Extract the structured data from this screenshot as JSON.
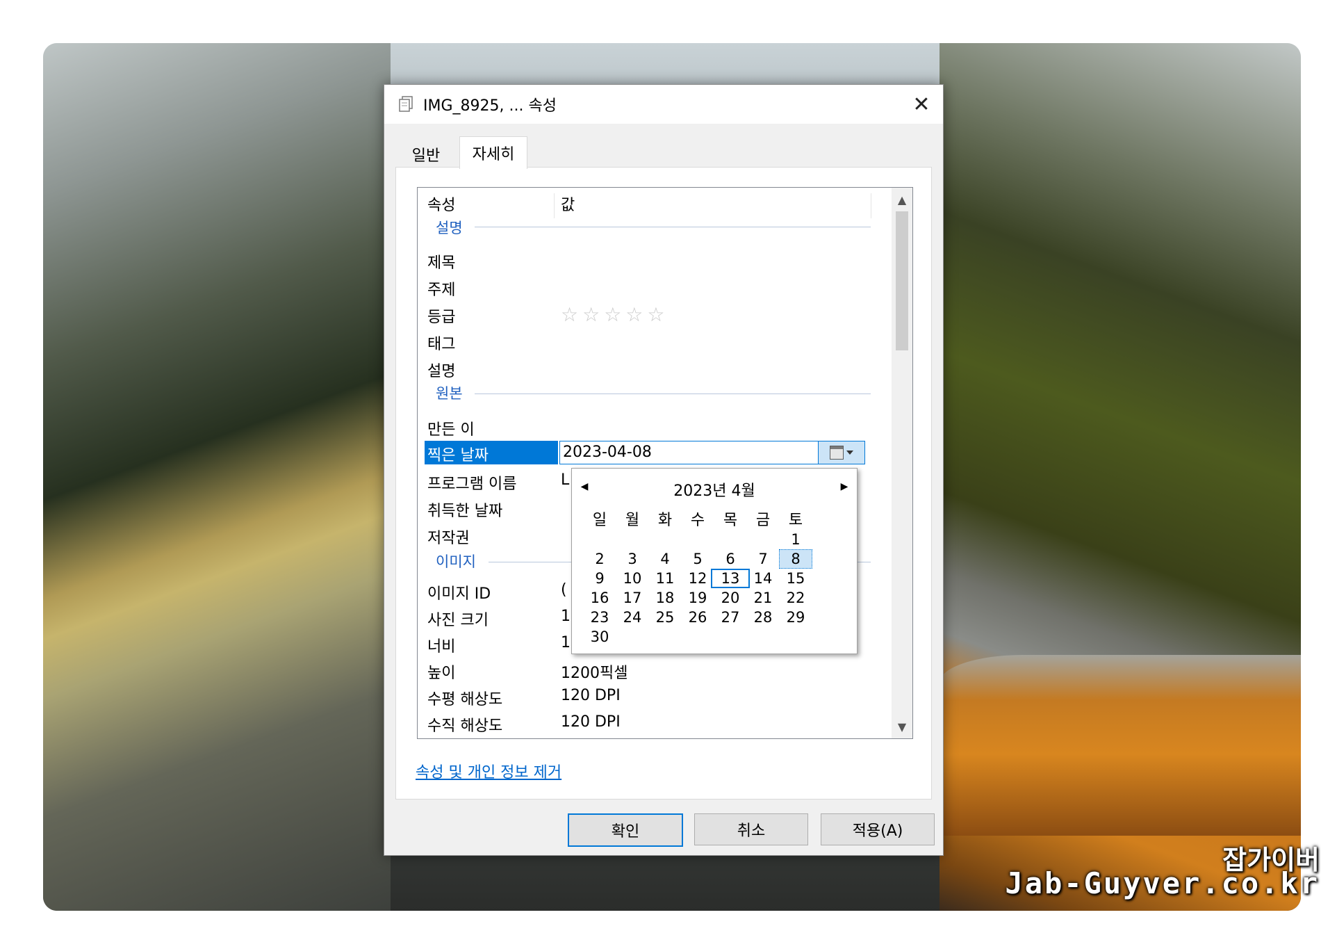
{
  "window": {
    "title": "IMG_8925, ... 속성",
    "close_glyph": "✕",
    "title_icon": "file-properties-icon"
  },
  "tabs": [
    {
      "label": "일반",
      "active": false
    },
    {
      "label": "자세히",
      "active": true
    }
  ],
  "list": {
    "headers": {
      "property": "속성",
      "value": "값"
    },
    "groups": {
      "description": "설명",
      "origin": "원본",
      "image": "이미지"
    },
    "rows": {
      "title": {
        "label": "제목",
        "value": ""
      },
      "subject": {
        "label": "주제",
        "value": ""
      },
      "rating": {
        "label": "등급",
        "value": "☆☆☆☆☆"
      },
      "tags": {
        "label": "태그",
        "value": ""
      },
      "comments": {
        "label": "설명",
        "value": ""
      },
      "authors": {
        "label": "만든 이",
        "value": ""
      },
      "date_taken": {
        "label": "찍은 날짜",
        "value": "2023-04-08"
      },
      "program_name": {
        "label": "프로그램 이름",
        "value": "L"
      },
      "date_acquired": {
        "label": "취득한 날짜",
        "value": ""
      },
      "copyright": {
        "label": "저작권",
        "value": ""
      },
      "image_id": {
        "label": "이미지 ID",
        "value": "("
      },
      "dimensions": {
        "label": "사진 크기",
        "value": "1"
      },
      "width": {
        "label": "너비",
        "value": "1"
      },
      "height": {
        "label": "높이",
        "value": "1200픽셀"
      },
      "h_resolution": {
        "label": "수평 해상도",
        "value": "120 DPI"
      },
      "v_resolution": {
        "label": "수직 해상도",
        "value": "120 DPI"
      }
    }
  },
  "remove_link": "속성 및 개인 정보 제거",
  "buttons": {
    "ok": "확인",
    "cancel": "취소",
    "apply": "적용(A)"
  },
  "calendar": {
    "title": "2023년 4월",
    "weekdays": [
      "일",
      "월",
      "화",
      "수",
      "목",
      "금",
      "토"
    ],
    "today": 13,
    "selected": 8,
    "weeks": [
      [
        "",
        "",
        "",
        "",
        "",
        "",
        "1"
      ],
      [
        "2",
        "3",
        "4",
        "5",
        "6",
        "7",
        "8"
      ],
      [
        "9",
        "10",
        "11",
        "12",
        "13",
        "14",
        "15"
      ],
      [
        "16",
        "17",
        "18",
        "19",
        "20",
        "21",
        "22"
      ],
      [
        "23",
        "24",
        "25",
        "26",
        "27",
        "28",
        "29"
      ],
      [
        "30",
        "",
        "",
        "",
        "",
        "",
        ""
      ]
    ]
  },
  "watermark": {
    "line1": "잡가이버",
    "line2": "Jab-Guyver.co.kr"
  },
  "colors": {
    "accent": "#0078d7",
    "link": "#0066cc",
    "group": "#1e5fbf"
  }
}
